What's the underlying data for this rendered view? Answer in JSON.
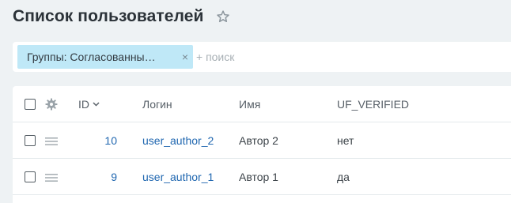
{
  "page": {
    "title": "Список пользователей"
  },
  "filter": {
    "chip_label": "Группы: Согласованны…",
    "chip_close": "×",
    "search_placeholder": "+ поиск"
  },
  "table": {
    "columns": {
      "id": "ID",
      "login": "Логин",
      "name": "Имя",
      "verified": "UF_VERIFIED"
    },
    "rows": [
      {
        "id": "10",
        "login": "user_author_2",
        "name": "Автор 2",
        "verified": "нет"
      },
      {
        "id": "9",
        "login": "user_author_1",
        "name": "Автор 1",
        "verified": "да"
      }
    ]
  },
  "colors": {
    "background": "#eef2f4",
    "chip": "#bfe8f7",
    "link": "#2067b0"
  },
  "icons": {
    "favorite": "star-icon",
    "settings": "gear-icon",
    "row_menu": "hamburger-icon",
    "sort": "chevron-down-icon",
    "remove_filter": "close-icon"
  }
}
